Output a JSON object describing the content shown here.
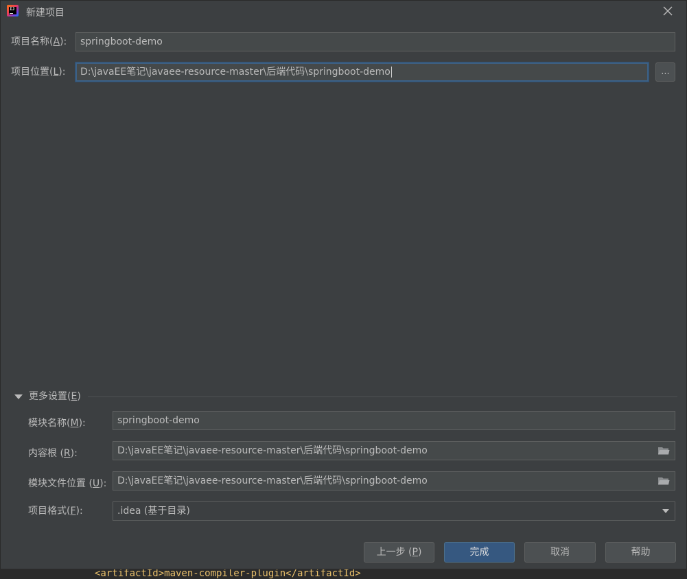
{
  "window": {
    "title": "新建项目",
    "icons": {
      "app": "intellij-idea-icon",
      "close": "close-icon"
    }
  },
  "project": {
    "name_label": "项目名称(",
    "name_mnemonic": "A",
    "name_suffix": "):",
    "name_value": "springboot-demo",
    "location_label": "项目位置(",
    "location_mnemonic": "L",
    "location_suffix": "):",
    "location_value": "D:\\javaEE笔记\\javaee-resource-master\\后端代码\\springboot-demo",
    "browse_label": "..."
  },
  "more_settings": {
    "label": "更多设置(",
    "mnemonic": "E",
    "suffix": ")",
    "module_name_label": "模块名称(",
    "module_name_mnemonic": "M",
    "module_name_suffix": "):",
    "module_name_value": "springboot-demo",
    "content_root_label": "内容根 (",
    "content_root_mnemonic": "R",
    "content_root_suffix": "):",
    "content_root_value": "D:\\javaEE笔记\\javaee-resource-master\\后端代码\\springboot-demo",
    "module_file_label": "模块文件位置 (",
    "module_file_mnemonic": "U",
    "module_file_suffix": "):",
    "module_file_value": "D:\\javaEE笔记\\javaee-resource-master\\后端代码\\springboot-demo",
    "format_label": "项目格式(",
    "format_mnemonic": "F",
    "format_suffix": "):",
    "format_value": ".idea (基于目录)"
  },
  "buttons": {
    "previous_label": "上一步 (",
    "previous_mnemonic": "P",
    "previous_suffix": ")",
    "finish": "完成",
    "cancel": "取消",
    "help": "帮助"
  },
  "background_code": "<artifactId>maven-compiler-plugin</artifactId>",
  "colors": {
    "focus_border": "#3d6185",
    "primary_button": "#365880",
    "dialog_bg": "#3c3f41"
  }
}
